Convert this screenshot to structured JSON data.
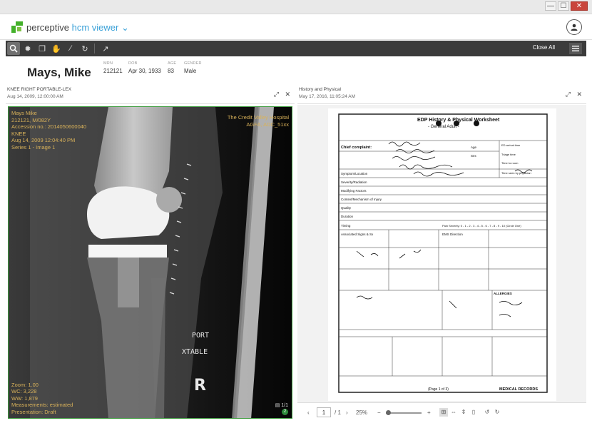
{
  "window": {
    "minimize_glyph": "—",
    "maximize_glyph": "☐",
    "close_glyph": "✕"
  },
  "app": {
    "brand": "perceptive",
    "product": "hcm viewer",
    "accent": "#3aa1d8",
    "logo_color": "#43b02a"
  },
  "toolbar": {
    "close_all": "Close All"
  },
  "patient": {
    "name": "Mays, Mike",
    "fields": [
      {
        "label": "MRN",
        "value": "212121"
      },
      {
        "label": "DOB",
        "value": "Apr 30, 1933"
      },
      {
        "label": "AGE",
        "value": "83"
      },
      {
        "label": "GENDER",
        "value": "Male"
      }
    ]
  },
  "left_panel": {
    "title": "KNEE RIGHT PORTABLE-LEX",
    "date": "Aug 14, 2009, 12:00:00 AM",
    "overlay_top_left": [
      "Mays Mike",
      "212121, M/082Y",
      "Accession no.: 2014050600040",
      "KNEE",
      "Aug 14, 2009 12:04:40 PM",
      "Series 1 - Image 1"
    ],
    "overlay_top_right": [
      "The Credit Valley Hospital",
      "AGFA, ADC_51xx"
    ],
    "overlay_bottom_left": [
      "Zoom: 1.00",
      "WC: 3,228",
      "WW: 1,879",
      "Measurements: estimated",
      "Presentation: Draft"
    ],
    "marker_port": "PORT",
    "marker_xtable": "XTABLE",
    "marker_r": "R",
    "page_counter": "1/1",
    "badge": "2"
  },
  "right_panel": {
    "title": "History and Physical",
    "date": "May 17, 2016, 11:05:24 AM",
    "document": {
      "header": "EDP History & Physical Worksheet",
      "subheader": "- General Adult -",
      "labels": {
        "chief_complaint": "Chief complaint:",
        "symptom": "Symptom/Location",
        "severity": "Severity/Radiation",
        "modifying": "Modifying Factors",
        "context": "Context/Mechanism of Injury",
        "quality": "Quality",
        "duration": "Duration",
        "timing": "Timing",
        "associated": "Associated Signs & Sx",
        "pain_severity": "Pain Severity: 0 - 1 - 2 - 3 - 4 - 5 - 6 - 7 - 8 - 9 - 10 (Circle One)",
        "ems": "EMS Direction",
        "allergies": "ALLERGIES",
        "age": "Age",
        "sex": "Sex",
        "ed_arrival": "ED arrival time",
        "triage": "Triage time",
        "time_to_room": "Time to room",
        "time_seen": "Time seen by physician",
        "page": "(Page 1 of 3)",
        "medical_records": "MEDICAL RECORDS"
      }
    },
    "footer": {
      "page_value": "1",
      "page_total": "/ 1",
      "zoom": "25%",
      "zoom_minus": "−",
      "zoom_plus": "+"
    }
  }
}
